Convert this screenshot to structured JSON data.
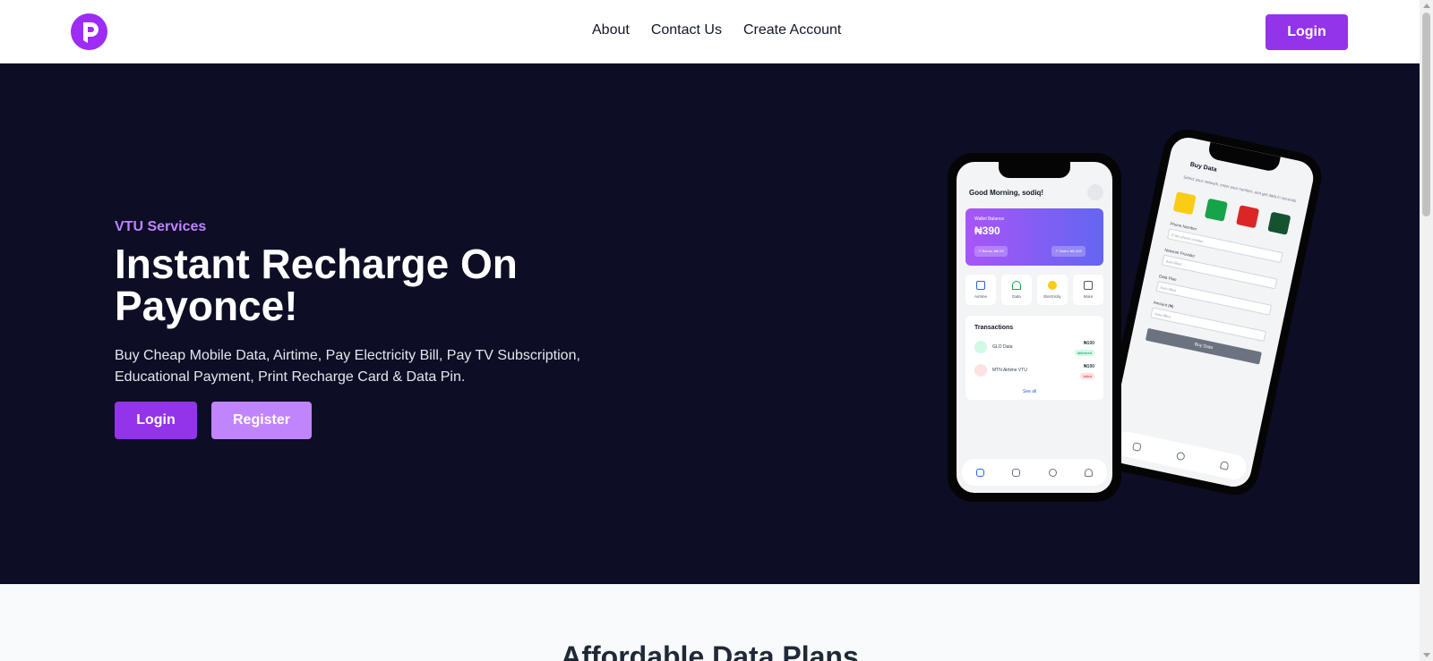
{
  "header": {
    "logo_letter": "P",
    "nav": [
      "About",
      "Contact Us",
      "Create Account"
    ],
    "login_label": "Login"
  },
  "hero": {
    "eyebrow": "VTU Services",
    "title": "Instant Recharge On Payonce!",
    "description": "Buy Cheap Mobile Data, Airtime, Pay Electricity Bill, Pay TV Subscription, Educational Payment, Print Recharge Card & Data Pin.",
    "login_label": "Login",
    "register_label": "Register"
  },
  "mockup_home": {
    "greeting": "Good Morning, sodiq!",
    "wallet_label": "Wallet Balance",
    "wallet_balance": "₦390",
    "bonus": "↗ Bonus: ₦0.00",
    "cashback": "↗ Claim: ₦1,000",
    "services": [
      "Airtime",
      "Data",
      "Electricity",
      "More"
    ],
    "transactions_title": "Transactions",
    "transactions": [
      {
        "name": "GLO Data",
        "amount": "₦100",
        "status": "delivered"
      },
      {
        "name": "MTN Airtime VTU",
        "amount": "₦100",
        "status": "failed"
      }
    ],
    "see_all": "See all"
  },
  "mockup_buy": {
    "title": "Buy Data",
    "subtitle": "Select your network, enter your number, and get data in seconds",
    "fields": [
      {
        "label": "Phone Number",
        "placeholder": "Enter phone number"
      },
      {
        "label": "Network Provider",
        "placeholder": "Auto-filled"
      },
      {
        "label": "Data Plan",
        "placeholder": "Auto-filled"
      },
      {
        "label": "Amount (₦)",
        "placeholder": "Auto-filled"
      }
    ],
    "buy_label": "Buy Data"
  },
  "next_section_title": "Affordable Data Plans",
  "colors": {
    "brand": "#9333ea",
    "brand_light": "#c084fc",
    "hero_bg": "#0d0d26"
  }
}
